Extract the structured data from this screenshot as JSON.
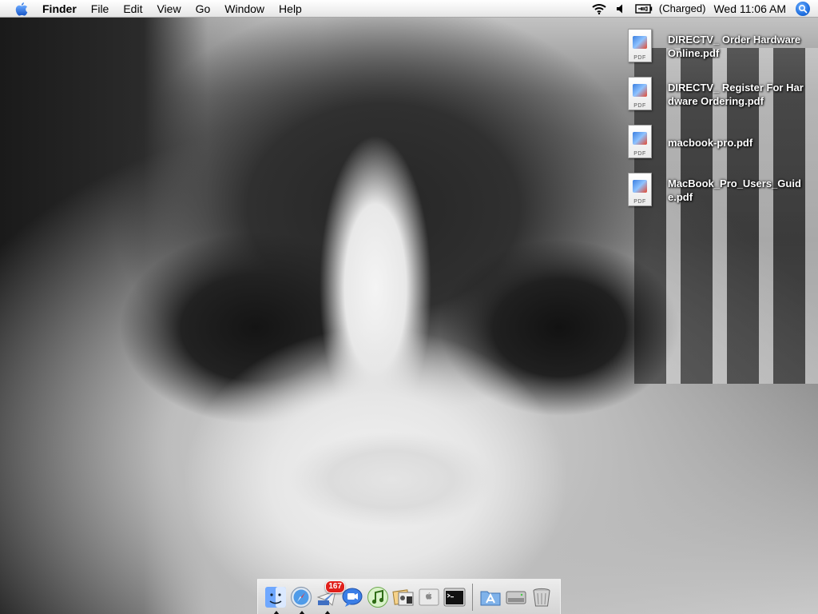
{
  "menubar": {
    "apple_menu": "apple-menu",
    "app_name": "Finder",
    "menus": [
      "File",
      "Edit",
      "View",
      "Go",
      "Window",
      "Help"
    ],
    "status": {
      "wifi_icon": "wifi-icon",
      "volume_icon": "volume-icon",
      "battery_icon": "battery-icon",
      "battery_text": "(Charged)",
      "clock": "Wed 11:06 AM",
      "spotlight_icon": "spotlight-icon"
    }
  },
  "desktop": {
    "files": [
      {
        "name": "DIRECTV_ Order Hardware Online.pdf",
        "icon": "pdf-file-icon",
        "type_label": "PDF"
      },
      {
        "name": "DIRECTV_ Register For Hardware Ordering.pdf",
        "icon": "pdf-file-icon",
        "type_label": "PDF"
      },
      {
        "name": "macbook-pro.pdf",
        "icon": "pdf-file-icon",
        "type_label": "PDF"
      },
      {
        "name": "MacBook_Pro_Users_Guide.pdf",
        "icon": "pdf-file-icon",
        "type_label": "PDF"
      }
    ]
  },
  "dock": {
    "apps": [
      {
        "name": "Finder",
        "icon": "finder-icon",
        "running": true
      },
      {
        "name": "Safari",
        "icon": "safari-icon",
        "running": true
      },
      {
        "name": "Mail",
        "icon": "mail-icon",
        "running": true,
        "badge": "167"
      },
      {
        "name": "iChat",
        "icon": "ichat-icon",
        "running": false
      },
      {
        "name": "iTunes",
        "icon": "itunes-icon",
        "running": false
      },
      {
        "name": "iPhoto",
        "icon": "iphoto-icon",
        "running": false
      },
      {
        "name": "Boot Camp Assistant",
        "icon": "bootcamp-icon",
        "running": false
      },
      {
        "name": "Terminal",
        "icon": "terminal-icon",
        "running": false
      }
    ],
    "others": [
      {
        "name": "Applications",
        "icon": "applications-folder-icon"
      },
      {
        "name": "Hard Drive",
        "icon": "hard-drive-icon"
      },
      {
        "name": "Trash",
        "icon": "trash-icon"
      }
    ]
  },
  "colors": {
    "menubar_top": "#ffffff",
    "menubar_bottom": "#e4e4e4",
    "badge_red": "#e0201b",
    "spotlight_blue": "#1f6fe0"
  }
}
